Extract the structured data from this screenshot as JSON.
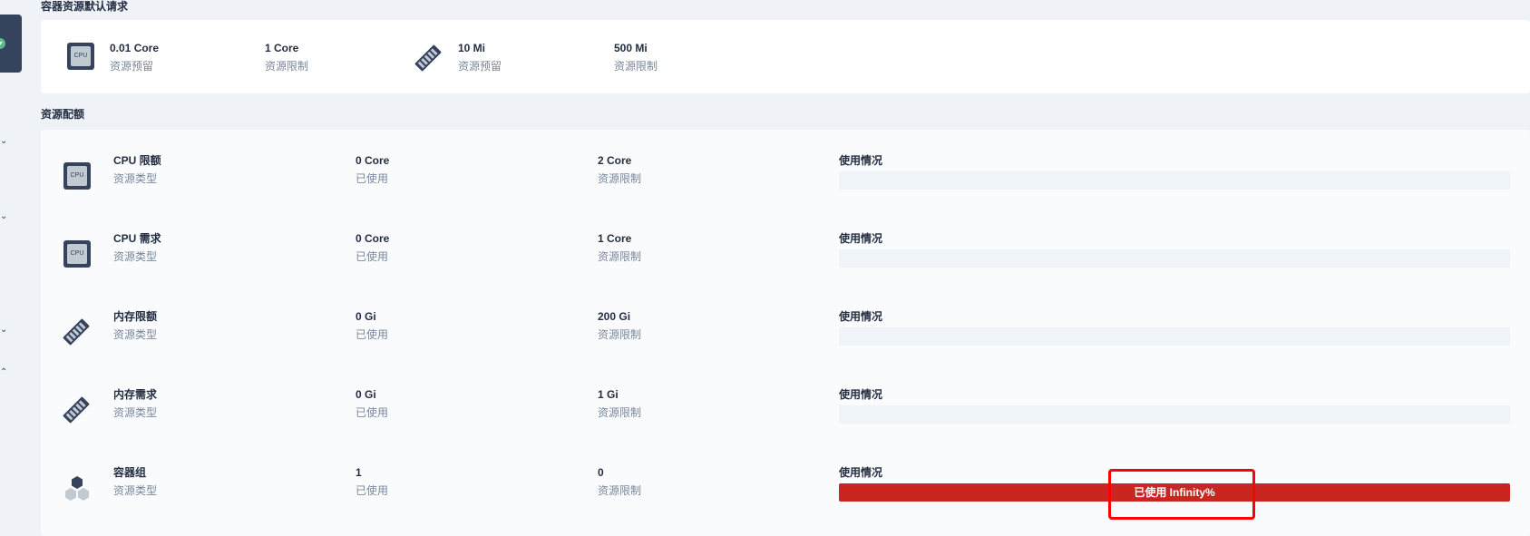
{
  "sidebar": {
    "toggle_icon": "chevron-down-circle-icon",
    "chevrons": [
      "chevron-down-icon",
      "chevron-down-icon",
      "chevron-down-icon",
      "chevron-up-icon"
    ]
  },
  "defaults": {
    "title": "容器资源默认请求",
    "items": [
      {
        "value": "0.01 Core",
        "label": "资源预留",
        "icon": "cpu-icon"
      },
      {
        "value": "1 Core",
        "label": "资源限制"
      },
      {
        "value": "10 Mi",
        "label": "资源预留",
        "icon": "memory-icon"
      },
      {
        "value": "500 Mi",
        "label": "资源限制"
      }
    ]
  },
  "quota": {
    "title": "资源配额",
    "rows": [
      {
        "name": "CPU 限额",
        "type_label": "资源类型",
        "used": "0 Core",
        "used_label": "已使用",
        "limit": "2 Core",
        "limit_label": "资源限制",
        "usage_label": "使用情况",
        "icon": "cpu-icon",
        "usage_fraction": 0
      },
      {
        "name": "CPU 需求",
        "type_label": "资源类型",
        "used": "0 Core",
        "used_label": "已使用",
        "limit": "1 Core",
        "limit_label": "资源限制",
        "usage_label": "使用情况",
        "icon": "cpu-icon",
        "usage_fraction": 0
      },
      {
        "name": "内存限额",
        "type_label": "资源类型",
        "used": "0 Gi",
        "used_label": "已使用",
        "limit": "200 Gi",
        "limit_label": "资源限制",
        "usage_label": "使用情况",
        "icon": "memory-icon",
        "usage_fraction": 0
      },
      {
        "name": "内存需求",
        "type_label": "资源类型",
        "used": "0 Gi",
        "used_label": "已使用",
        "limit": "1 Gi",
        "limit_label": "资源限制",
        "usage_label": "使用情况",
        "icon": "memory-icon",
        "usage_fraction": 0
      },
      {
        "name": "容器组",
        "type_label": "资源类型",
        "used": "1",
        "used_label": "已使用",
        "limit": "0",
        "limit_label": "资源限制",
        "usage_label": "使用情况",
        "icon": "pod-icon",
        "usage_fraction": 1,
        "usage_text": "已使用 Infinity%"
      }
    ]
  },
  "colors": {
    "background": "#eff3f7",
    "card": "#ffffff",
    "primary_text": "#242e42",
    "secondary_text": "#79879c",
    "danger": "#ca2621",
    "highlight_box": "#ff0000"
  }
}
